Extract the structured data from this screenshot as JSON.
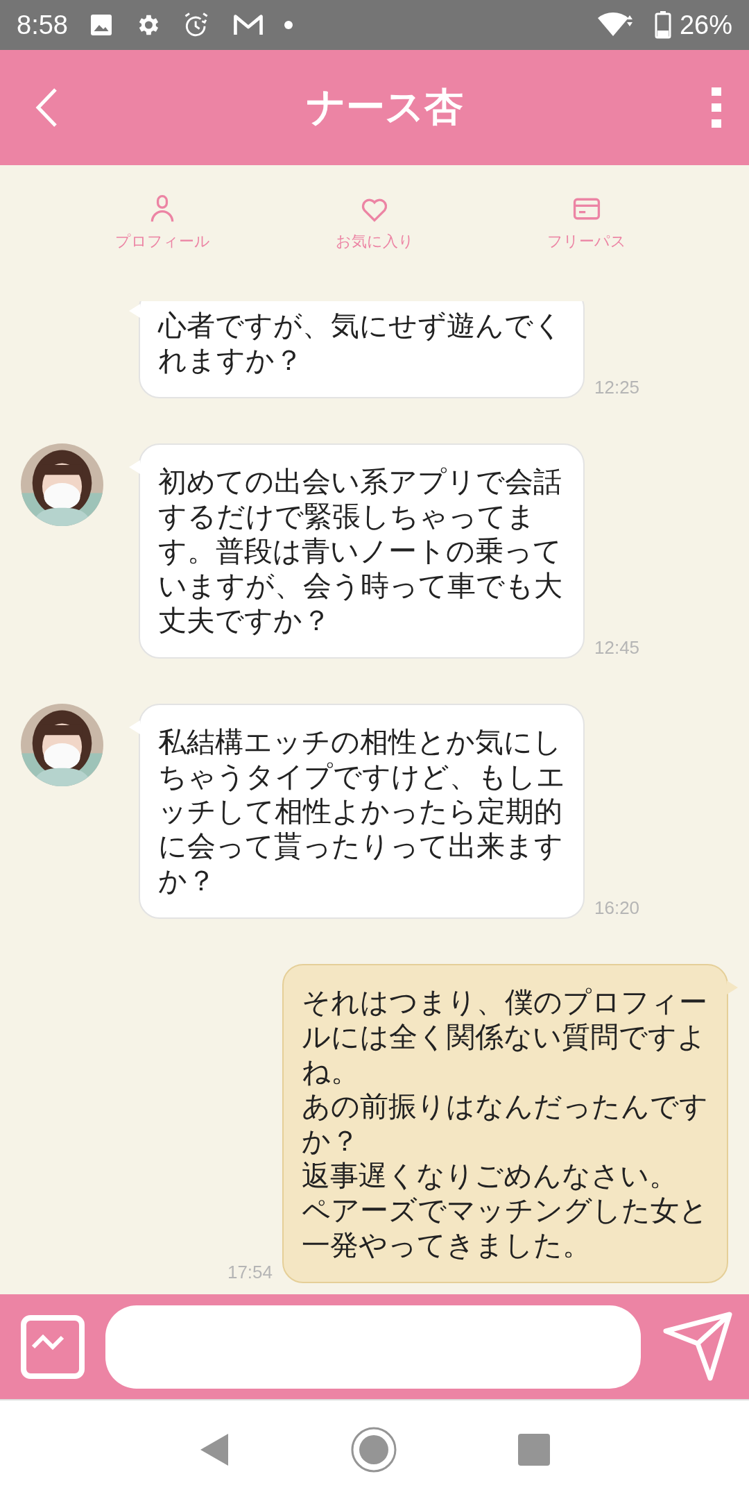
{
  "status_bar": {
    "time": "8:58",
    "battery": "26%"
  },
  "header": {
    "title": "ナース杏"
  },
  "tabs": [
    {
      "kind": "profile",
      "label": "プロフィール"
    },
    {
      "kind": "favorite",
      "label": "お気に入り"
    },
    {
      "kind": "pass",
      "label": "フリーパス"
    }
  ],
  "messages": [
    {
      "kind": "received",
      "avatar": false,
      "text": "心者ですが、気にせず遊んでくれますか？",
      "time": "12:25"
    },
    {
      "kind": "received",
      "avatar": true,
      "text": "初めての出会い系アプリで会話するだけで緊張しちゃってます。普段は青いノートの乗っていますが、会う時って車でも大丈夫ですか？",
      "time": "12:45"
    },
    {
      "kind": "received",
      "avatar": true,
      "text": "私結構エッチの相性とか気にしちゃうタイプですけど、もしエッチして相性よかったら定期的に会って貰ったりって出来ますか？",
      "time": "16:20"
    },
    {
      "kind": "sent",
      "lines": [
        "それはつまり、僕のプロフィールには全く関係ない質問ですよね。",
        "あの前振りはなんだったんですか？",
        "返事遅くなりごめんなさい。",
        "ペアーズでマッチングした女と一発やってきました。"
      ],
      "time": "17:54"
    }
  ]
}
